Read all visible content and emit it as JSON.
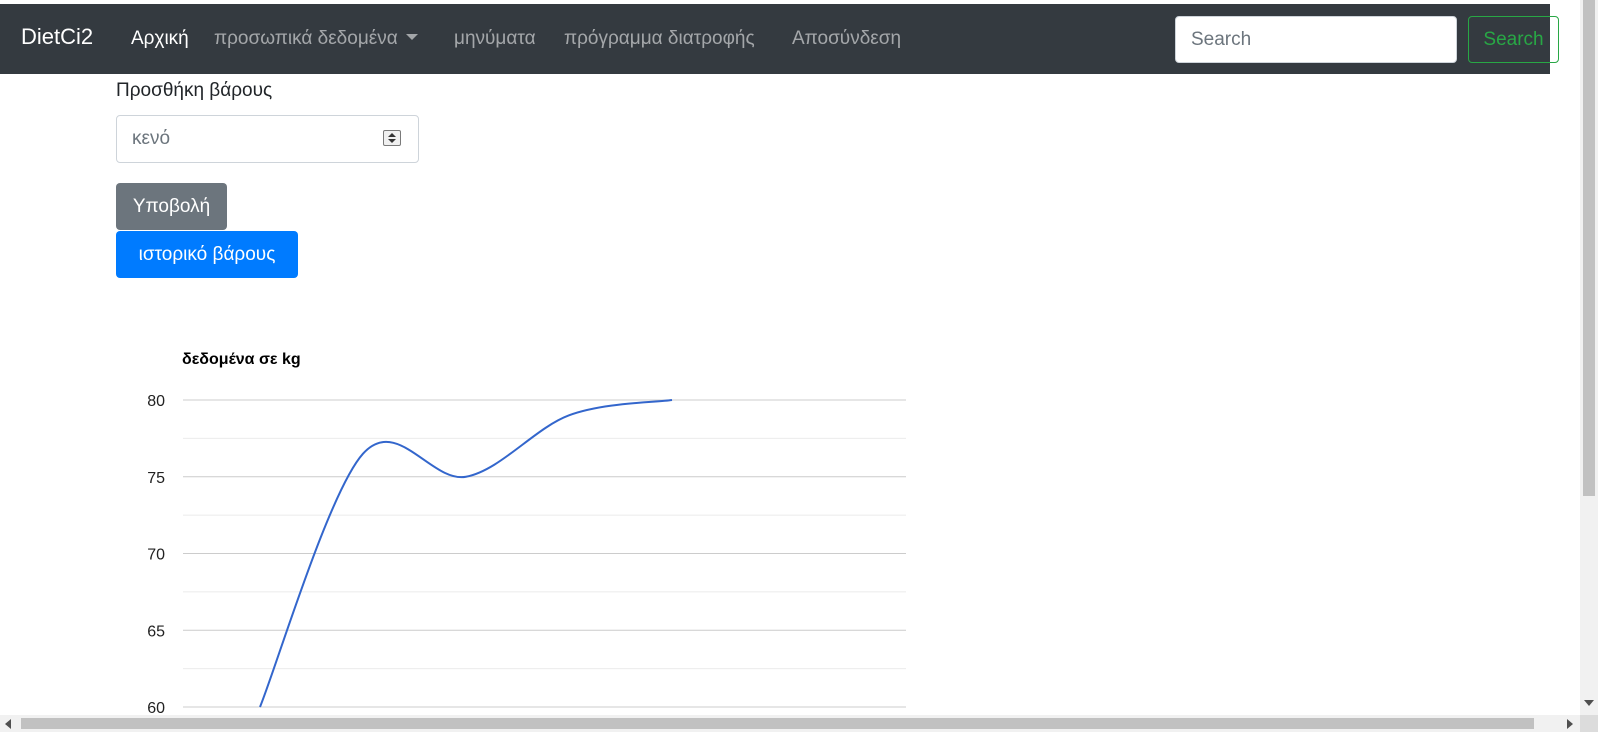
{
  "navbar": {
    "brand": "DietCi2",
    "links": [
      {
        "label": "Αρχική",
        "active": true
      },
      {
        "label": "προσωπικά δεδομένα",
        "dropdown": true
      },
      {
        "label": "μηνύματα"
      },
      {
        "label": "πρόγραμμα διατροφής"
      },
      {
        "label": "Αποσύνδεση"
      }
    ],
    "search_placeholder": "Search",
    "search_button": "Search"
  },
  "form": {
    "label": "Προσθήκη βάρους",
    "weight_placeholder": "κενό",
    "submit_button": "Υποβολή",
    "history_button": "ιστορικό βάρους"
  },
  "chart_data": {
    "type": "line",
    "title": "δεδομένα σε kg",
    "yticks": [
      80,
      75,
      70,
      65,
      60
    ],
    "ylim": [
      60,
      80
    ],
    "grid": true,
    "line_color": "#3366cc",
    "series": [
      {
        "values": [
          60,
          76.5,
          75,
          79,
          80
        ]
      }
    ]
  },
  "colors": {
    "navbar_bg": "#343a40",
    "primary": "#007bff",
    "secondary": "#6c757d",
    "success": "#28a745"
  }
}
